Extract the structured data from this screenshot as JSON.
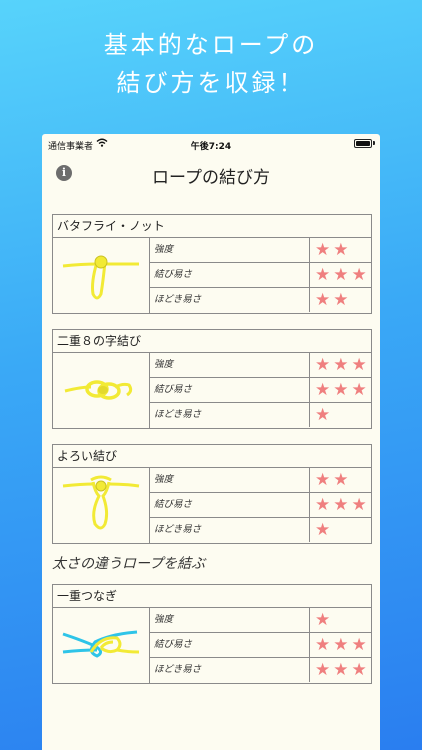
{
  "promo": {
    "line1": "基本的なロープの",
    "line2": "結び方を収録！"
  },
  "status_bar": {
    "carrier": "通信事業者",
    "time": "午後7:24"
  },
  "nav": {
    "title": "ロープの結び方",
    "info_icon": "i"
  },
  "rating_labels": {
    "strength": "強度",
    "ease_tie": "結び易さ",
    "ease_untie": "ほどき易さ"
  },
  "colors": {
    "star": "#ef7f7f",
    "rope_yellow": "#f2ea35",
    "rope_blue": "#2ec4e8",
    "bg_top": "#57d3fb",
    "bg_bottom": "#2a7ef0"
  },
  "knots": [
    {
      "name": "バタフライ・ノット",
      "strength": "★★",
      "ease_tie": "★★★",
      "ease_untie": "★★"
    },
    {
      "name": "二重８の字結び",
      "strength": "★★★",
      "ease_tie": "★★★",
      "ease_untie": "★"
    },
    {
      "name": "よろい結び",
      "strength": "★★",
      "ease_tie": "★★★",
      "ease_untie": "★"
    },
    {
      "name": "一重つなぎ",
      "strength": "★",
      "ease_tie": "★★★",
      "ease_untie": "★★★"
    }
  ],
  "section": {
    "heading": "太さの違うロープを結ぶ"
  }
}
